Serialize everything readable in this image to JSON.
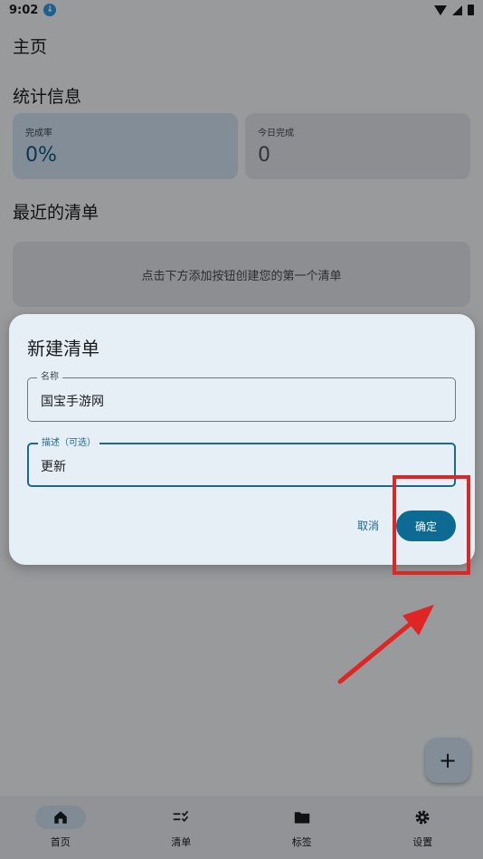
{
  "status_bar": {
    "time": "9:02",
    "notification_icon": "download-badge-icon",
    "icons": [
      "wifi-icon",
      "signal-icon",
      "battery-icon"
    ]
  },
  "header": {
    "title": "主页"
  },
  "stats": {
    "title": "统计信息",
    "cards": [
      {
        "label": "完成率",
        "value": "0%"
      },
      {
        "label": "今日完成",
        "value": "0"
      }
    ]
  },
  "recent": {
    "title": "最近的清单",
    "empty_text": "点击下方添加按钮创建您的第一个清单"
  },
  "fab": {
    "label": "+"
  },
  "bottom_nav": {
    "items": [
      {
        "label": "首页",
        "icon": "home-icon",
        "active": true
      },
      {
        "label": "清单",
        "icon": "checklist-icon",
        "active": false
      },
      {
        "label": "标签",
        "icon": "folder-icon",
        "active": false
      },
      {
        "label": "设置",
        "icon": "gear-icon",
        "active": false
      }
    ]
  },
  "dialog": {
    "title": "新建清单",
    "name_field": {
      "label": "名称",
      "value": "国宝手游网"
    },
    "desc_field": {
      "label": "描述（可选）",
      "value": "更新"
    },
    "cancel_label": "取消",
    "confirm_label": "确定"
  },
  "colors": {
    "accent": "#0c6a93",
    "annotation": "#e02525",
    "card_primary": "#d2e4f4",
    "card_secondary": "#e3e6ec"
  }
}
